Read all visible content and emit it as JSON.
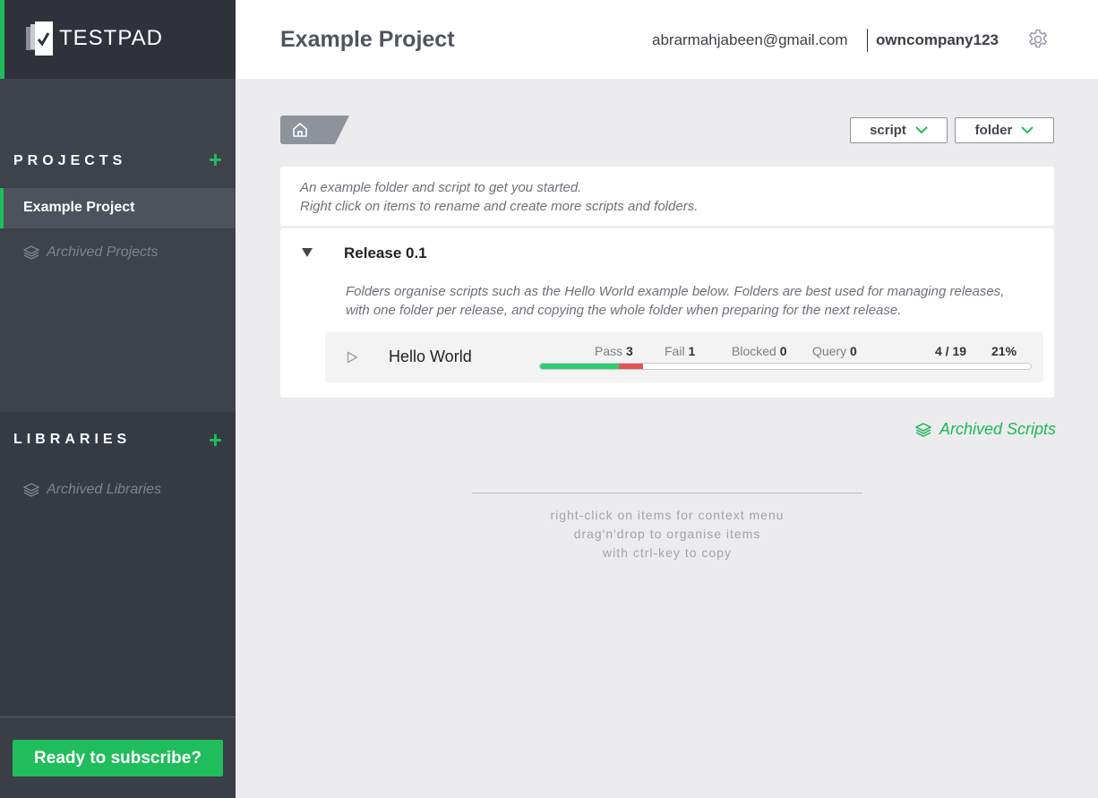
{
  "brand": {
    "name": "TESTPAD"
  },
  "sidebar": {
    "projects": {
      "title": "PROJECTS",
      "add_label": "+",
      "items": [
        {
          "label": "Example Project",
          "active": true
        }
      ],
      "archived_label": "Archived Projects"
    },
    "libraries": {
      "title": "LIBRARIES",
      "add_label": "+",
      "archived_label": "Archived Libraries"
    },
    "subscribe_label": "Ready to subscribe?"
  },
  "header": {
    "title": "Example Project",
    "user_email": "abrarmahjabeen@gmail.com",
    "company": "owncompany123",
    "settings_icon": "gear-icon"
  },
  "toolbar": {
    "home_icon": "home-icon",
    "script_dropdown": "script",
    "folder_dropdown": "folder"
  },
  "intro": {
    "line1": "An example folder and script to get you started.",
    "line2": "Right click on items to rename and create more scripts and folders."
  },
  "folder": {
    "title": "Release 0.1",
    "description": "Folders organise scripts such as the Hello World example below. Folders are best used for managing releases, with one folder per release, and copying the whole folder when preparing for the next release.",
    "scripts": [
      {
        "name": "Hello World",
        "pass_label": "Pass",
        "pass": "3",
        "fail_label": "Fail",
        "fail": "1",
        "blocked_label": "Blocked",
        "blocked": "0",
        "query_label": "Query",
        "query": "0",
        "count": "4 / 19",
        "percent": "21%",
        "progress": {
          "pass_fraction": 0.16,
          "fail_fraction": 0.05
        }
      }
    ]
  },
  "archived_scripts_label": "Archived Scripts",
  "hints": {
    "line1": "right-click on items for context menu",
    "line2": "drag'n'drop to organise items",
    "line3": "with ctrl-key to copy"
  },
  "colors": {
    "accent": "#1fbd5b",
    "pass": "#2ecc71",
    "fail": "#e05555"
  }
}
